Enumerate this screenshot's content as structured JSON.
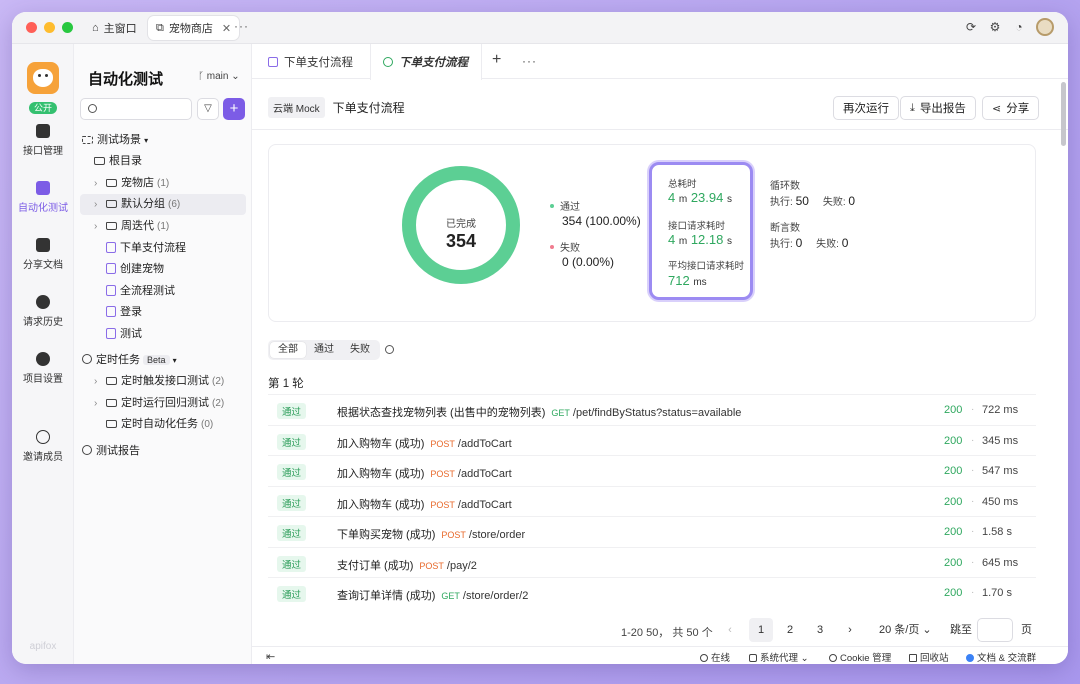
{
  "window": {
    "tabs": [
      {
        "label": "主窗口",
        "icon": "home-icon"
      },
      {
        "label": "宠物商店",
        "icon": "external-link-icon"
      }
    ]
  },
  "rail": {
    "public_badge": "公开",
    "items": [
      {
        "label": "接口管理",
        "icon": "api-icon"
      },
      {
        "label": "自动化测试",
        "icon": "automation-icon",
        "active": true
      },
      {
        "label": "分享文档",
        "icon": "book-icon"
      },
      {
        "label": "请求历史",
        "icon": "history-icon"
      },
      {
        "label": "项目设置",
        "icon": "settings-icon"
      },
      {
        "label": "邀请成员",
        "icon": "add-user-icon"
      }
    ],
    "brand": "apifox"
  },
  "tree": {
    "title": "自动化测试",
    "branch": "main",
    "search_placeholder": "",
    "scenarios_label": "测试场景",
    "root": "根目录",
    "folders": [
      {
        "label": "宠物店",
        "count": "(1)"
      },
      {
        "label": "默认分组",
        "count": "(6)"
      },
      {
        "label": "周迭代",
        "count": "(1)"
      }
    ],
    "cases": [
      "下单支付流程",
      "创建宠物",
      "全流程测试",
      "登录",
      "测试"
    ],
    "scheduled_label": "定时任务",
    "beta": "Beta",
    "scheduled": [
      {
        "label": "定时触发接口测试",
        "count": "(2)"
      },
      {
        "label": "定时运行回归测试",
        "count": "(2)"
      },
      {
        "label": "定时自动化任务",
        "count": "(0)"
      }
    ],
    "reports_label": "测试报告"
  },
  "main": {
    "tabs": [
      "下单支付流程",
      "下单支付流程"
    ],
    "env_tag": "云端 Mock",
    "case_name": "下单支付流程",
    "buttons": {
      "rerun": "再次运行",
      "export": "导出报告",
      "share": "分享"
    },
    "summary": {
      "done_label": "已完成",
      "done_count": "354",
      "pass_label": "通过",
      "pass_value": "354 (100.00%)",
      "fail_label": "失败",
      "fail_value": "0 (0.00%)",
      "pass_ratio": 1.0,
      "total_time_label": "总耗时",
      "total_time_min": "4",
      "total_time_min_unit": "m",
      "total_time_sec": "23.94",
      "total_time_sec_unit": "s",
      "api_time_label": "接口请求耗时",
      "api_time_min": "4",
      "api_time_min_unit": "m",
      "api_time_sec": "12.18",
      "api_time_sec_unit": "s",
      "avg_time_label": "平均接口请求耗时",
      "avg_time_value": "712",
      "avg_time_unit": "ms",
      "loop_label": "循环数",
      "loop_exec_label": "执行:",
      "loop_exec": "50",
      "loop_fail_label": "失败:",
      "loop_fail": "0",
      "assert_label": "断言数",
      "assert_exec_label": "执行:",
      "assert_exec": "0",
      "assert_fail_label": "失败:",
      "assert_fail": "0",
      "colors": {
        "pass": "#5ccf94",
        "fail": "#f07c8f",
        "highlight": "#9c8bf2"
      }
    },
    "filters": [
      "全部",
      "通过",
      "失败"
    ],
    "round_title": "第 1 轮",
    "rows": [
      {
        "status": "通过",
        "name": "根据状态查找宠物列表 (出售中的宠物列表)",
        "method": "GET",
        "path": "/pet/findByStatus?status=available",
        "code": "200",
        "time": "722 ms"
      },
      {
        "status": "通过",
        "name": "加入购物车 (成功)",
        "method": "POST",
        "path": "/addToCart",
        "code": "200",
        "time": "345 ms"
      },
      {
        "status": "通过",
        "name": "加入购物车 (成功)",
        "method": "POST",
        "path": "/addToCart",
        "code": "200",
        "time": "547 ms"
      },
      {
        "status": "通过",
        "name": "加入购物车 (成功)",
        "method": "POST",
        "path": "/addToCart",
        "code": "200",
        "time": "450 ms"
      },
      {
        "status": "通过",
        "name": "下单购买宠物 (成功)",
        "method": "POST",
        "path": "/store/order",
        "code": "200",
        "time": "1.58 s"
      },
      {
        "status": "通过",
        "name": "支付订单 (成功)",
        "method": "POST",
        "path": "/pay/2",
        "code": "200",
        "time": "645 ms"
      },
      {
        "status": "通过",
        "name": "查询订单详情 (成功)",
        "method": "GET",
        "path": "/store/order/2",
        "code": "200",
        "time": "1.70 s"
      }
    ],
    "pagination": {
      "summary": "1-20 50， 共 50 个",
      "prev": "‹",
      "pages": [
        "1",
        "2",
        "3"
      ],
      "next": "›",
      "page_size": "20 条/页",
      "jump_label": "跳至",
      "jump_value": "",
      "page_unit": "页"
    }
  },
  "statusbar": {
    "collapse": "⇤",
    "online": "在线",
    "proxy": "系统代理",
    "cookie": "Cookie 管理",
    "trash": "回收站",
    "docs": "文档 & 交流群"
  }
}
